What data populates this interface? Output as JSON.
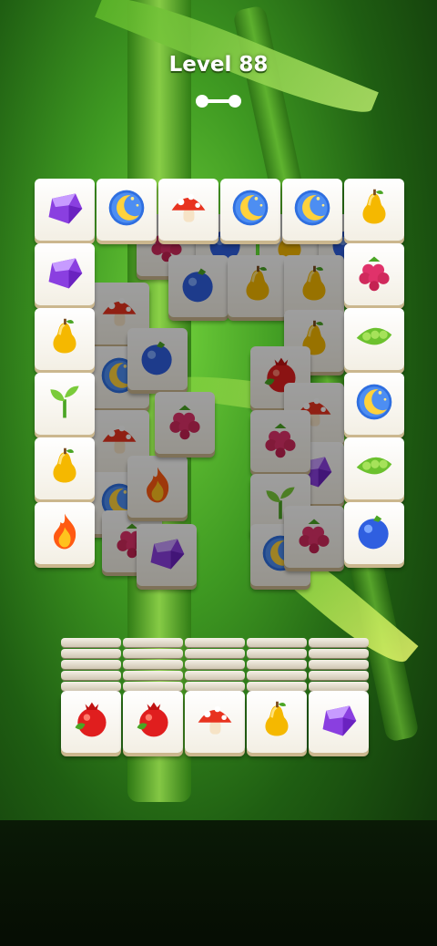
{
  "header": {
    "level_label": "Level 88"
  },
  "board": {
    "left_column": [
      "gem",
      "gem",
      "pear",
      "sprout",
      "pear",
      "fire"
    ],
    "right_column": [
      "pear",
      "raspberry",
      "peas",
      "moon",
      "peas",
      "blueberry"
    ],
    "top_row": [
      "gem",
      "moon",
      "mushroom",
      "moon",
      "moon",
      "pear"
    ],
    "inner_covered_left": [
      "mushroom",
      "moon",
      "mushroom",
      "moon",
      "raspberry",
      "blueberry",
      "fire",
      "raspberry",
      "gem"
    ],
    "inner_covered_right": [
      "pear",
      "pomegranate",
      "mushroom",
      "gem",
      "raspberry",
      "sprout",
      "moon",
      "raspberry"
    ],
    "inner_covered_top": [
      "raspberry",
      "blueberry",
      "pear",
      "blueberry"
    ]
  },
  "tray": {
    "front_tiles": [
      "pomegranate",
      "pomegranate",
      "mushroom",
      "pear",
      "gem"
    ]
  },
  "colors": {
    "accent": "#ffffff",
    "tile_face": "#fbf8f0",
    "tile_edge": "#cbb78e"
  }
}
